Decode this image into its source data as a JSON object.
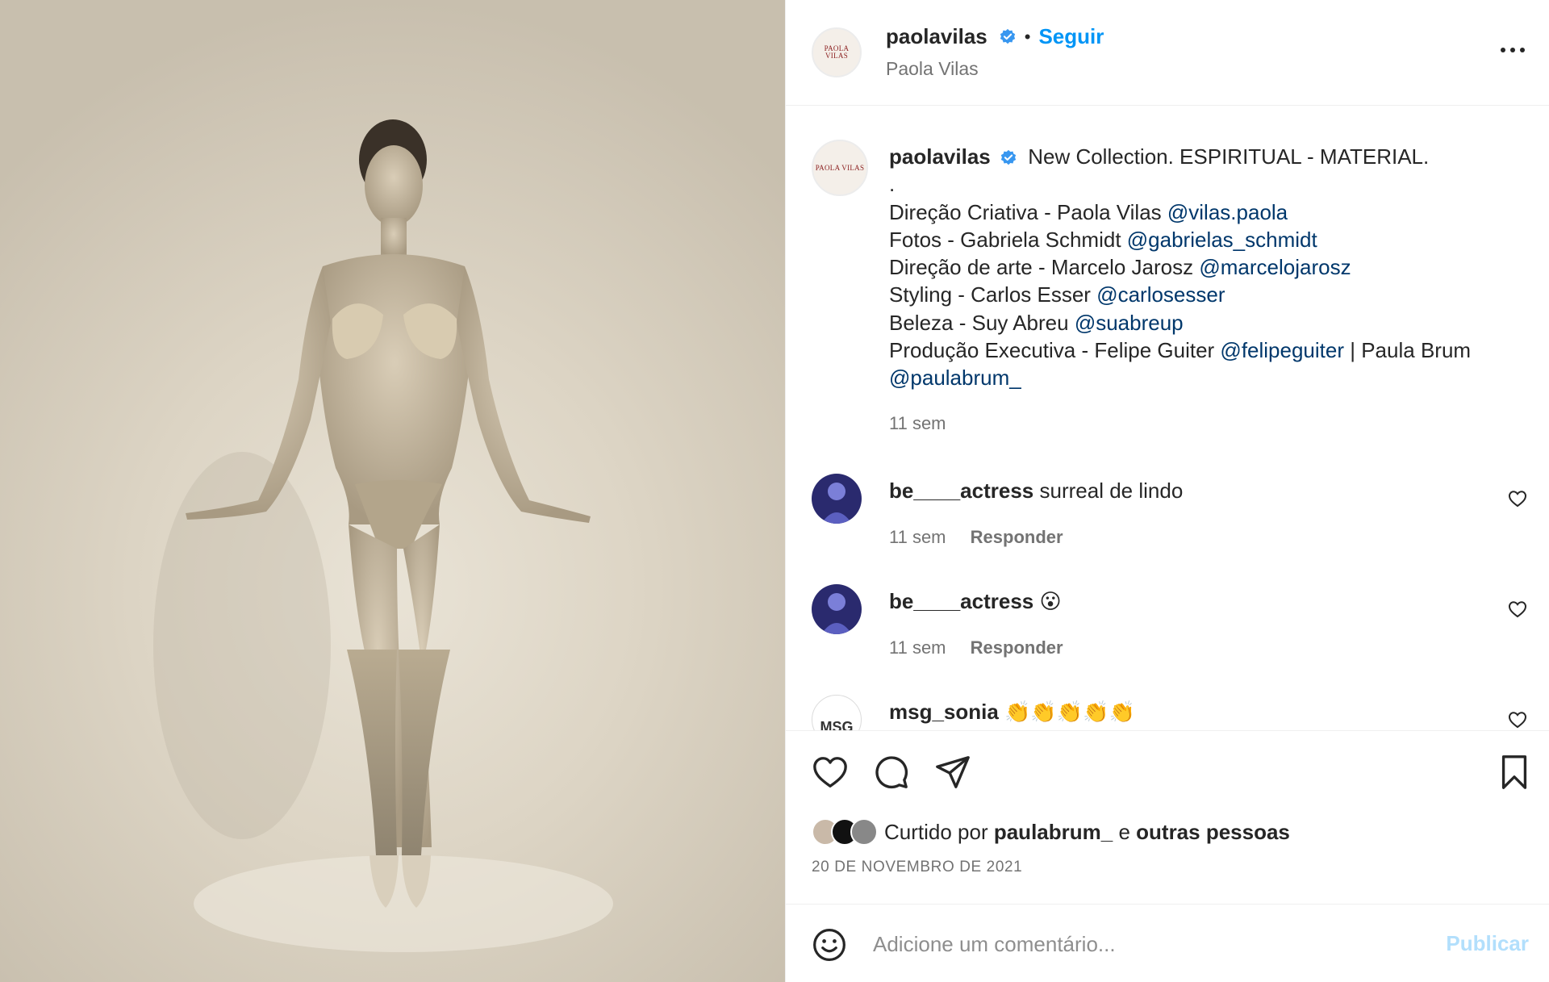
{
  "photo": {
    "alt_subject": "fashion-photo"
  },
  "header": {
    "brand_avatar_text": "PAOLA VILAS",
    "username": "paolavilas",
    "dot": "•",
    "follow_label": "Seguir",
    "display_name": "Paola Vilas",
    "more_icon": "more-horizontal-icon"
  },
  "caption": {
    "username": "paolavilas",
    "title": "New Collection. ESPIRITUAL - MATERIAL.",
    "dot_line": ".",
    "lines": [
      {
        "text": "Direção Criativa - Paola Vilas ",
        "mention": "@vilas.paola"
      },
      {
        "text": "Fotos - Gabriela Schmidt ",
        "mention": "@gabrielas_schmidt"
      },
      {
        "text": "Direção de arte - Marcelo Jarosz ",
        "mention": "@marcelojarosz"
      },
      {
        "text": "Styling - Carlos Esser ",
        "mention": "@carlosesser"
      },
      {
        "text": "Beleza - Suy Abreu ",
        "mention": "@suabreup"
      },
      {
        "text": "Produção Executiva - Felipe Guiter ",
        "mention": "@felipeguiter",
        "suffix": " | Paula Brum"
      }
    ],
    "last_mention": "@paulabrum_",
    "time": "11 sem"
  },
  "comments": [
    {
      "username": "be____actress",
      "text": "surreal de lindo",
      "time": "11 sem",
      "reply": "Responder"
    },
    {
      "username": "be____actress",
      "text": "😮",
      "time": "11 sem",
      "reply": "Responder"
    },
    {
      "username": "msg_sonia",
      "text": "👏👏👏👏👏",
      "avatar_text": "MSG"
    }
  ],
  "actions": {
    "like_icon": "heart-icon",
    "comment_icon": "comment-icon",
    "share_icon": "send-icon",
    "save_icon": "bookmark-icon",
    "liked_by_prefix": "Curtido por ",
    "liked_by_user": "paulabrum_",
    "liked_by_joiner": " e ",
    "liked_by_others": "outras pessoas",
    "date": "20 DE NOVEMBRO DE 2021"
  },
  "comment_box": {
    "placeholder": "Adicione um comentário...",
    "publish_label": "Publicar",
    "emoji_icon": "emoji-icon"
  },
  "colors": {
    "link_blue": "#0095f6",
    "mention_blue": "#00376b",
    "muted": "#737373",
    "publish_disabled": "#b2dffc"
  }
}
